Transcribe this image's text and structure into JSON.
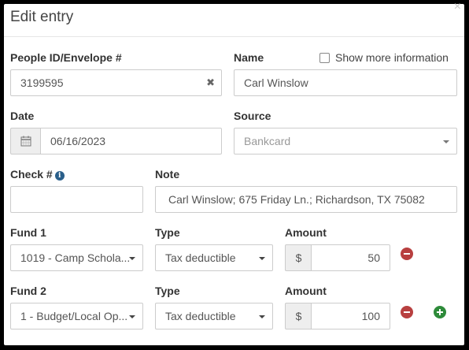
{
  "modal": {
    "title": "Edit entry",
    "close_glyph": "×"
  },
  "people": {
    "label": "People ID/Envelope #",
    "value": "3199595",
    "clear_glyph": "✖"
  },
  "name": {
    "label": "Name",
    "value": "Carl Winslow",
    "show_more_label": "Show more information",
    "show_more_checked": false
  },
  "date": {
    "label": "Date",
    "value": "06/16/2023",
    "icon": "calendar-icon"
  },
  "source": {
    "label": "Source",
    "value": "Bankcard"
  },
  "check": {
    "label": "Check #",
    "info_glyph": "i",
    "value": ""
  },
  "note": {
    "label": "Note",
    "value": "Carl Winslow; 675 Friday Ln.; Richardson, TX 75082"
  },
  "fund_rows": [
    {
      "fund_label": "Fund 1",
      "fund_value": "1019 - Camp Schola...",
      "type_label": "Type",
      "type_value": "Tax deductible",
      "amount_label": "Amount",
      "currency": "$",
      "amount_value": "50"
    },
    {
      "fund_label": "Fund 2",
      "fund_value": "1 - Budget/Local Op...",
      "type_label": "Type",
      "type_value": "Tax deductible",
      "amount_label": "Amount",
      "currency": "$",
      "amount_value": "100"
    }
  ],
  "colors": {
    "remove": "#b84040",
    "add": "#2e8b3a",
    "info": "#2a5f8a"
  }
}
